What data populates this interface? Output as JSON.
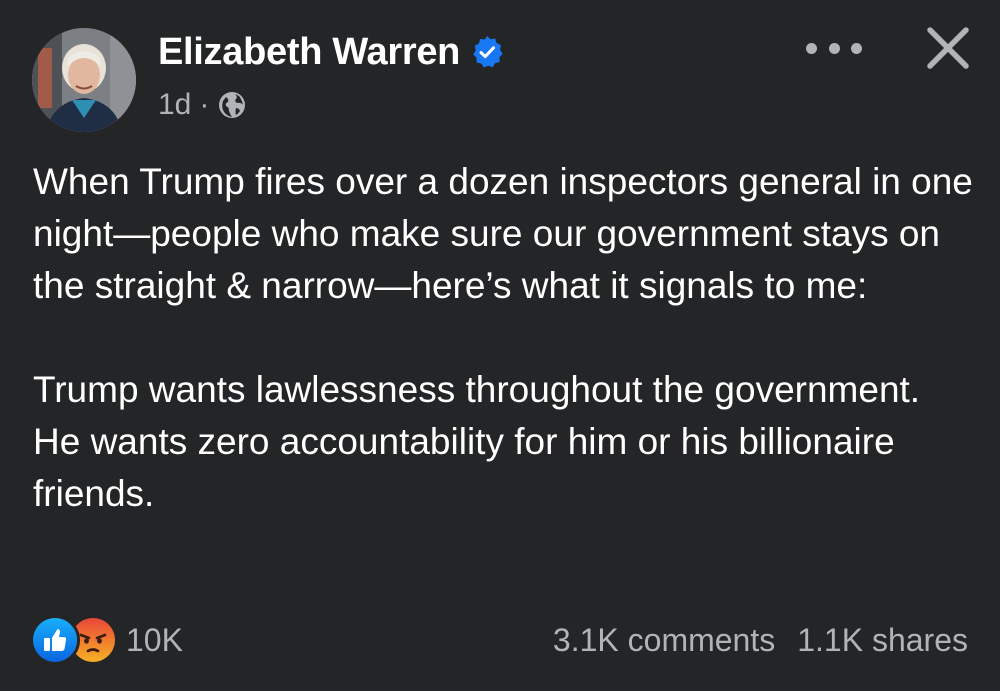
{
  "post": {
    "author": {
      "name": "Elizabeth Warren",
      "verified_icon": "verified-badge-icon",
      "avatar": "author-avatar"
    },
    "meta": {
      "time": "1d",
      "separator": "·",
      "audience_icon": "globe-icon"
    },
    "actions": {
      "more_icon": "more-options-icon",
      "close_icon": "close-icon"
    },
    "body": {
      "paragraphs": [
        "When Trump fires over a dozen inspectors general in one night—people who make sure our government stays on the straight & narrow—here’s what it signals to me:",
        "Trump wants lawlessness throughout the government. He wants zero accountability for him or his billionaire friends."
      ]
    },
    "reactions": {
      "icons": [
        "like-reaction-icon",
        "angry-reaction-icon"
      ],
      "count": "10K"
    },
    "engagement": {
      "comments": "3.1K comments",
      "shares": "1.1K shares"
    },
    "colors": {
      "background": "#242526",
      "primary_text": "#ffffff",
      "secondary_text": "#b0b3b8",
      "verified_blue": "#1877f2",
      "like_blue": "#1877f2",
      "angry_orange": "#f26d3d"
    }
  }
}
